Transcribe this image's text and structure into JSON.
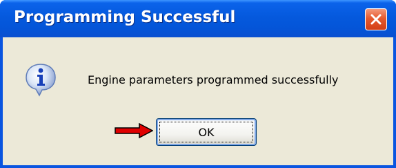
{
  "window": {
    "title": "Programming Successful",
    "close_icon": "close-icon"
  },
  "message": {
    "icon": "info-icon",
    "text": "Engine parameters programmed successfully"
  },
  "buttons": {
    "ok_label": "OK"
  },
  "annotation": {
    "icon": "red-arrow-icon",
    "color": "#e00000"
  },
  "colors": {
    "titlebar": "#0559dd",
    "client_bg": "#ece9d8",
    "close_button": "#e65a2f"
  }
}
